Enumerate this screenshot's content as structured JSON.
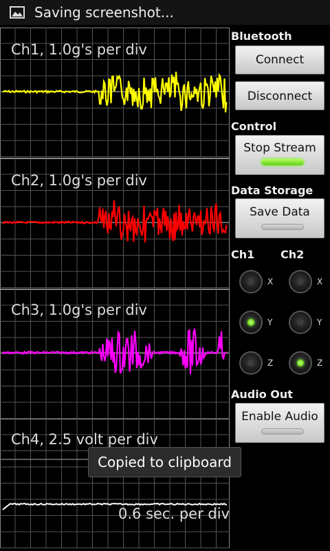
{
  "status_bar": {
    "icon": "image-icon",
    "text": "Saving screenshot..."
  },
  "scope": {
    "channels": [
      {
        "label": "Ch1, 1.0g's per div",
        "color": "#ffff00"
      },
      {
        "label": "Ch2, 1.0g's per div",
        "color": "#ff0000"
      },
      {
        "label": "Ch3, 1.0g's per div",
        "color": "#ff00ff"
      },
      {
        "label": "Ch4, 2.5 volt per div",
        "color": "#ffffff"
      }
    ],
    "timebase": "0.6 sec. per div"
  },
  "panel": {
    "bluetooth": {
      "title": "Bluetooth",
      "connect": "Connect",
      "disconnect": "Disconnect"
    },
    "control": {
      "title": "Control",
      "stop_stream": "Stop Stream",
      "stream_on": true
    },
    "storage": {
      "title": "Data Storage",
      "save_data": "Save Data",
      "save_on": false
    },
    "channel_select": {
      "ch1_title": "Ch1",
      "ch2_title": "Ch2",
      "axes": [
        "X",
        "Y",
        "Z"
      ],
      "ch1_selected": "Y",
      "ch2_selected": "Z"
    },
    "audio": {
      "title": "Audio Out",
      "enable": "Enable Audio",
      "audio_on": false
    }
  },
  "toast": "Copied to clipboard",
  "colors": {
    "indicator_on": "#7ee22a",
    "grid": "#555555"
  }
}
